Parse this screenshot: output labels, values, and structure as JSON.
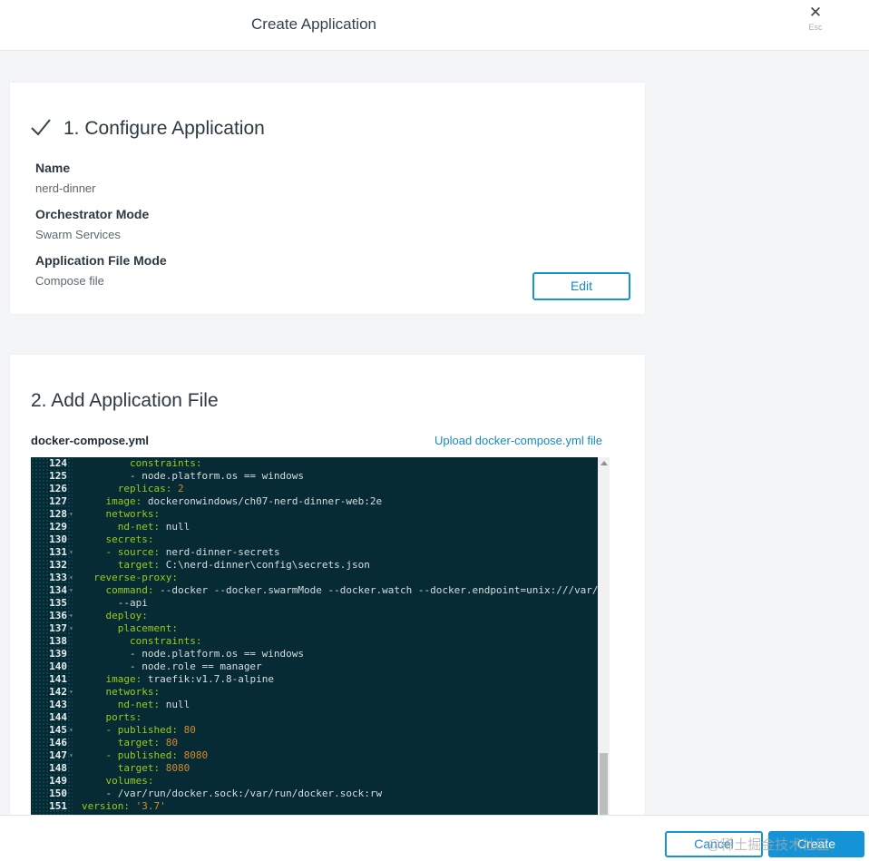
{
  "header": {
    "title": "Create Application",
    "close_label": "Esc"
  },
  "step1": {
    "title": "1. Configure Application",
    "fields": [
      {
        "label": "Name",
        "value": "nerd-dinner"
      },
      {
        "label": "Orchestrator Mode",
        "value": "Swarm Services"
      },
      {
        "label": "Application File Mode",
        "value": "Compose file"
      }
    ],
    "edit_label": "Edit"
  },
  "step2": {
    "title": "2. Add Application File",
    "file_label": "docker-compose.yml",
    "upload_label": "Upload docker-compose.yml file"
  },
  "editor_lines": [
    {
      "num": "124",
      "fold": false,
      "indent": "        ",
      "key": "constraints:",
      "val": ""
    },
    {
      "num": "125",
      "fold": false,
      "indent": "        ",
      "key": "",
      "val": "- node.platform.os == windows"
    },
    {
      "num": "126",
      "fold": false,
      "indent": "      ",
      "key": "replicas:",
      "val": " 2",
      "numeric": true
    },
    {
      "num": "127",
      "fold": false,
      "indent": "    ",
      "key": "image:",
      "val": " dockeronwindows/ch07-nerd-dinner-web:2e"
    },
    {
      "num": "128",
      "fold": true,
      "indent": "    ",
      "key": "networks:",
      "val": ""
    },
    {
      "num": "129",
      "fold": false,
      "indent": "      ",
      "key": "nd-net:",
      "val": " null"
    },
    {
      "num": "130",
      "fold": false,
      "indent": "    ",
      "key": "secrets:",
      "val": ""
    },
    {
      "num": "131",
      "fold": true,
      "indent": "    ",
      "key": "- source:",
      "val": " nerd-dinner-secrets"
    },
    {
      "num": "132",
      "fold": false,
      "indent": "      ",
      "key": "target:",
      "val": " C:\\nerd-dinner\\config\\secrets.json"
    },
    {
      "num": "133",
      "fold": true,
      "indent": "  ",
      "key": "reverse-proxy:",
      "val": ""
    },
    {
      "num": "134",
      "fold": true,
      "indent": "    ",
      "key": "command:",
      "val": " --docker --docker.swarmMode --docker.watch --docker.endpoint=unix:///var/"
    },
    {
      "num": "135",
      "fold": false,
      "indent": "      ",
      "key": "",
      "val": "--api"
    },
    {
      "num": "136",
      "fold": true,
      "indent": "    ",
      "key": "deploy:",
      "val": ""
    },
    {
      "num": "137",
      "fold": true,
      "indent": "      ",
      "key": "placement:",
      "val": ""
    },
    {
      "num": "138",
      "fold": false,
      "indent": "        ",
      "key": "constraints:",
      "val": ""
    },
    {
      "num": "139",
      "fold": false,
      "indent": "        ",
      "key": "",
      "val": "- node.platform.os == windows"
    },
    {
      "num": "140",
      "fold": false,
      "indent": "        ",
      "key": "",
      "val": "- node.role == manager"
    },
    {
      "num": "141",
      "fold": false,
      "indent": "    ",
      "key": "image:",
      "val": " traefik:v1.7.8-alpine"
    },
    {
      "num": "142",
      "fold": true,
      "indent": "    ",
      "key": "networks:",
      "val": ""
    },
    {
      "num": "143",
      "fold": false,
      "indent": "      ",
      "key": "nd-net:",
      "val": " null"
    },
    {
      "num": "144",
      "fold": false,
      "indent": "    ",
      "key": "ports:",
      "val": ""
    },
    {
      "num": "145",
      "fold": true,
      "indent": "    ",
      "key": "- published:",
      "val": " 80",
      "numeric": true
    },
    {
      "num": "146",
      "fold": false,
      "indent": "      ",
      "key": "target:",
      "val": " 80",
      "numeric": true
    },
    {
      "num": "147",
      "fold": true,
      "indent": "    ",
      "key": "- published:",
      "val": " 8080",
      "numeric": true
    },
    {
      "num": "148",
      "fold": false,
      "indent": "      ",
      "key": "target:",
      "val": " 8080",
      "numeric": true
    },
    {
      "num": "149",
      "fold": false,
      "indent": "    ",
      "key": "volumes:",
      "val": ""
    },
    {
      "num": "150",
      "fold": false,
      "indent": "    ",
      "key": "",
      "val": "- /var/run/docker.sock:/var/run/docker.sock:rw"
    },
    {
      "num": "151",
      "fold": false,
      "indent": "",
      "key": "version:",
      "val": " '3.7'",
      "numeric": true
    }
  ],
  "footer": {
    "cancel_label": "Cancel",
    "create_label": "Create",
    "watermark": "@稀土掘金技术社区"
  },
  "colors": {
    "accent": "#1494d6",
    "editor_bg": "#062b35",
    "yaml_key": "#9cc91e",
    "yaml_number": "#d38b2a"
  },
  "icons": {
    "close": "close-icon",
    "check": "check-icon",
    "fold": "fold-arrow-icon"
  }
}
